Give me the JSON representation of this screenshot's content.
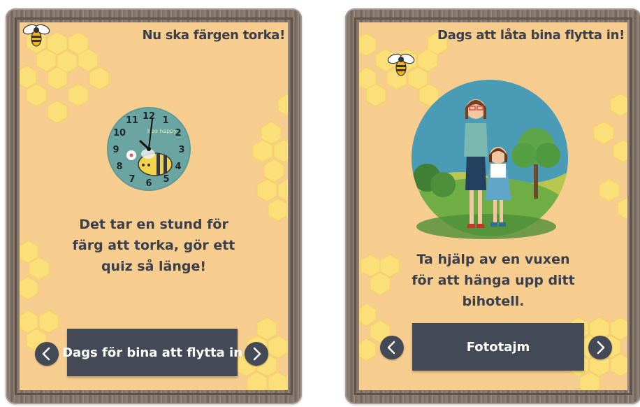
{
  "slides": [
    {
      "title": "Nu ska färgen torka!",
      "illustration": "bee-clock",
      "clock": {
        "text": "bee happy",
        "numbers": [
          "12",
          "1",
          "2",
          "3",
          "4",
          "5",
          "6",
          "7",
          "8",
          "9",
          "10",
          "11"
        ]
      },
      "body_lines": [
        "Det tar en stund för",
        "färg att torka, gör ett",
        "quiz så länge!"
      ],
      "button_label": "Dags för bina att flytta in",
      "prev_icon": "chevron-left-icon",
      "next_icon": "chevron-right-icon"
    },
    {
      "title": "Dags att låta bina flytta in!",
      "illustration": "mother-and-daughter-in-park",
      "body_lines": [
        "Ta hjälp av en vuxen",
        "för att hänga upp ditt",
        "bihotell."
      ],
      "button_label": "Fototajm",
      "prev_icon": "chevron-left-icon",
      "next_icon": "chevron-right-icon"
    }
  ],
  "colors": {
    "panel": "#f7cd8f",
    "honeycomb": "#fbe07a",
    "button": "#444a55",
    "text": "#3a3f4b",
    "frame": "#7d6e63"
  }
}
